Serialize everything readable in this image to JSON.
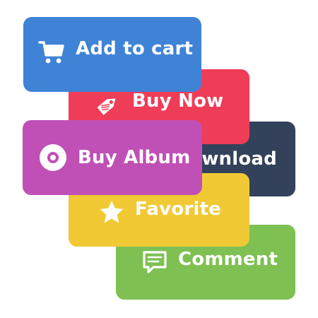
{
  "colors": {
    "add_to_cart": "#3f83d6",
    "buy_now": "#ef3d57",
    "download": "#33425a",
    "buy_album": "#c050b6",
    "favorite": "#f0c935",
    "comment": "#7fc052",
    "icon": "#ffffff"
  },
  "buttons": {
    "add_to_cart": {
      "label": "Add to cart",
      "icon": "shopping-cart-icon"
    },
    "buy_now": {
      "label": "Buy Now",
      "icon": "price-tag-icon"
    },
    "download": {
      "label": "wnload",
      "icon": "download-icon"
    },
    "buy_album": {
      "label": "Buy Album",
      "icon": "disc-icon"
    },
    "favorite": {
      "label": "Favorite",
      "icon": "star-icon"
    },
    "comment": {
      "label": "Comment",
      "icon": "speech-bubble-icon"
    }
  }
}
